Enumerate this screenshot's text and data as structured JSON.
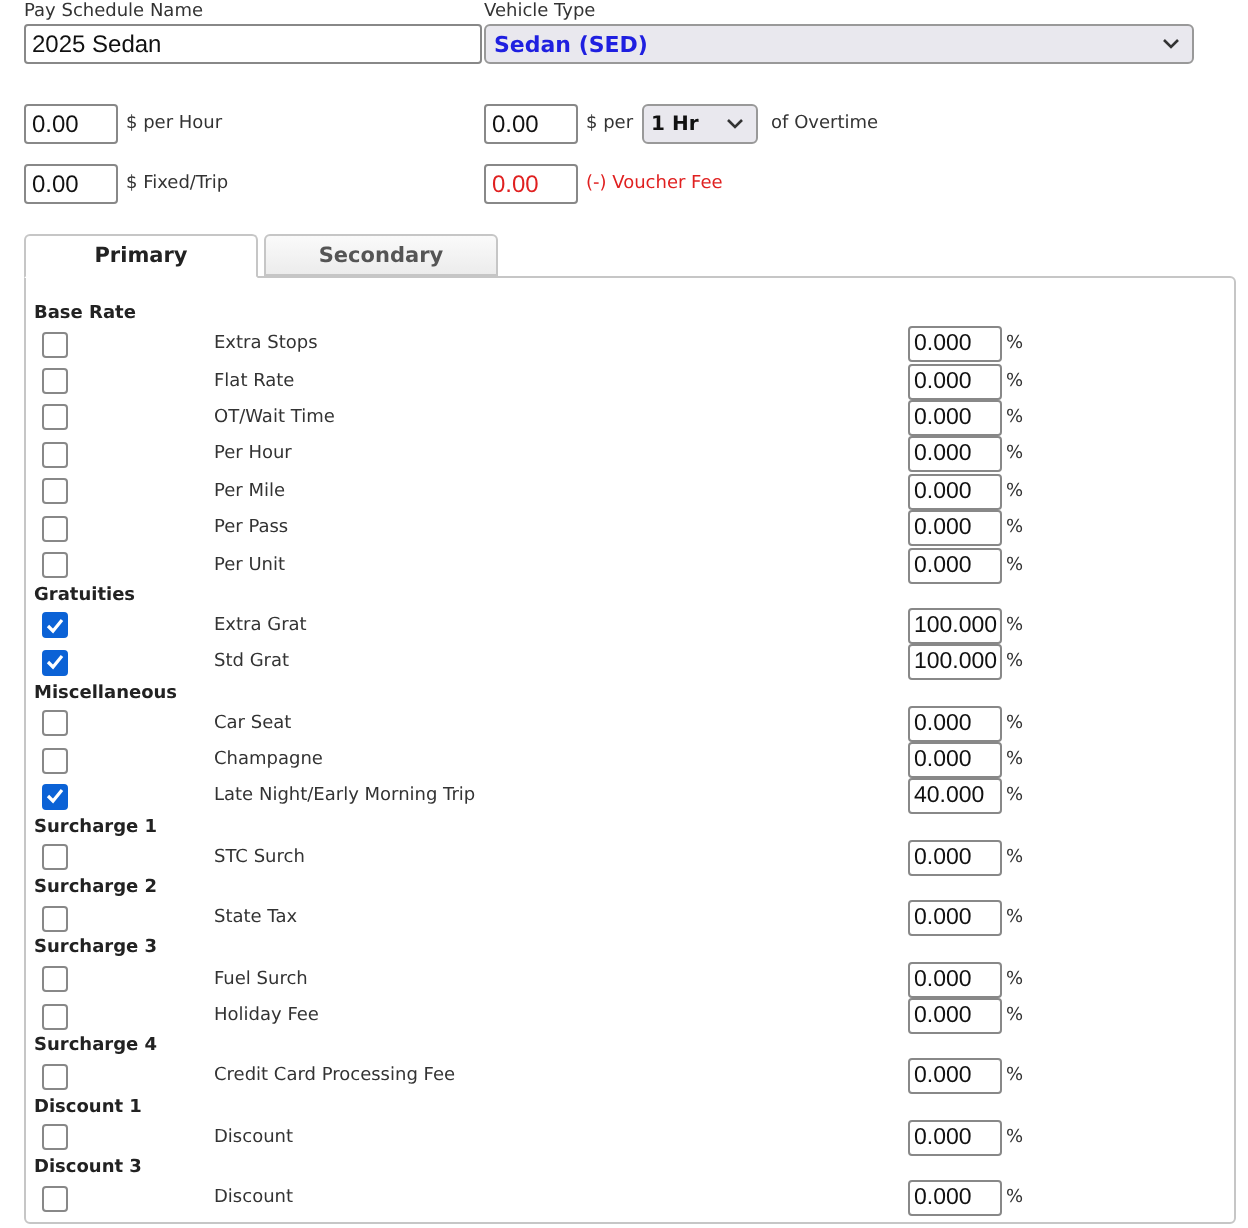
{
  "pay_schedule_name": {
    "label": "Pay Schedule Name",
    "value": "2025 Sedan"
  },
  "vehicle_type": {
    "label": "Vehicle Type",
    "value": "Sedan (SED)"
  },
  "per_hour": {
    "value": "0.00",
    "label": "$ per Hour"
  },
  "overtime": {
    "value": "0.00",
    "label": "$ per",
    "unit": "1 Hr",
    "suffix": "of Overtime"
  },
  "fixed_trip": {
    "value": "0.00",
    "label": "$ Fixed/Trip"
  },
  "voucher_fee": {
    "value": "0.00",
    "label": "(-) Voucher Fee"
  },
  "tabs": [
    {
      "label": "Primary",
      "selected": true
    },
    {
      "label": "Secondary",
      "selected": false
    }
  ],
  "sections": [
    {
      "name": "Base Rate",
      "items": [
        {
          "label": "Extra Stops",
          "checked": false,
          "value": "0.000",
          "unit": "%"
        },
        {
          "label": "Flat Rate",
          "checked": false,
          "value": "0.000",
          "unit": "%"
        },
        {
          "label": "OT/Wait Time",
          "checked": false,
          "value": "0.000",
          "unit": "%"
        },
        {
          "label": "Per Hour",
          "checked": false,
          "value": "0.000",
          "unit": "%"
        },
        {
          "label": "Per Mile",
          "checked": false,
          "value": "0.000",
          "unit": "%"
        },
        {
          "label": "Per Pass",
          "checked": false,
          "value": "0.000",
          "unit": "%"
        },
        {
          "label": "Per Unit",
          "checked": false,
          "value": "0.000",
          "unit": "%"
        }
      ]
    },
    {
      "name": "Gratuities",
      "items": [
        {
          "label": "Extra Grat",
          "checked": true,
          "value": "100.000",
          "unit": "%"
        },
        {
          "label": "Std Grat",
          "checked": true,
          "value": "100.000",
          "unit": "%"
        }
      ]
    },
    {
      "name": "Miscellaneous",
      "items": [
        {
          "label": "Car Seat",
          "checked": false,
          "value": "0.000",
          "unit": "%"
        },
        {
          "label": "Champagne",
          "checked": false,
          "value": "0.000",
          "unit": "%"
        },
        {
          "label": "Late Night/Early Morning Trip",
          "checked": true,
          "value": "40.000",
          "unit": "%"
        }
      ]
    },
    {
      "name": "Surcharge 1",
      "items": [
        {
          "label": "STC Surch",
          "checked": false,
          "value": "0.000",
          "unit": "%"
        }
      ]
    },
    {
      "name": "Surcharge 2",
      "items": [
        {
          "label": "State Tax",
          "checked": false,
          "value": "0.000",
          "unit": "%"
        }
      ]
    },
    {
      "name": "Surcharge 3",
      "items": [
        {
          "label": "Fuel Surch",
          "checked": false,
          "value": "0.000",
          "unit": "%"
        },
        {
          "label": "Holiday Fee",
          "checked": false,
          "value": "0.000",
          "unit": "%"
        }
      ]
    },
    {
      "name": "Surcharge 4",
      "items": [
        {
          "label": "Credit Card Processing Fee",
          "checked": false,
          "value": "0.000",
          "unit": "%"
        }
      ]
    },
    {
      "name": "Discount 1",
      "items": [
        {
          "label": "Discount",
          "checked": false,
          "value": "0.000",
          "unit": "%"
        }
      ]
    },
    {
      "name": "Discount 3",
      "items": [
        {
          "label": "Discount",
          "checked": false,
          "value": "0.000",
          "unit": "%"
        }
      ]
    }
  ]
}
